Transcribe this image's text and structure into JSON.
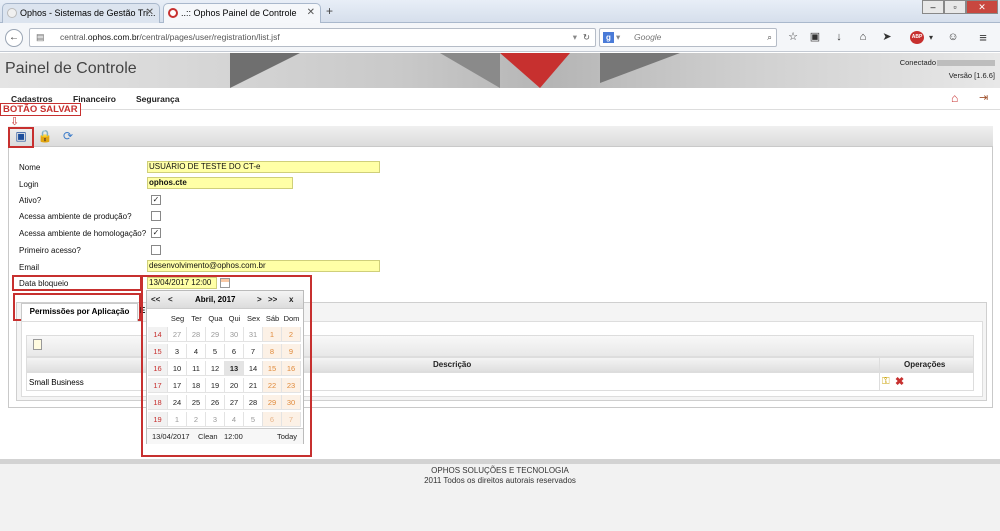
{
  "browser": {
    "tabs": [
      {
        "title": "Ophos - Sistemas de Gestão Tri...",
        "active": false
      },
      {
        "title": "..:: Ophos Painel de Controle",
        "active": true
      }
    ],
    "new_tab_label": "+",
    "url_prefix": "central.",
    "url_domain": "ophos.com.br",
    "url_path": "/central/pages/user/registration/list.jsf",
    "search_placeholder": "Google"
  },
  "app": {
    "title": "Painel de Controle",
    "connected_label": "Conectado",
    "version": "Versão [1.6.6]",
    "menu": [
      "Cadastros",
      "Financeiro",
      "Segurança"
    ]
  },
  "annotation": {
    "label": "BOTÃO SALVAR"
  },
  "form": {
    "fields": {
      "nome": {
        "label": "Nome",
        "value": "USUÁRIO DE TESTE DO CT-e"
      },
      "login": {
        "label": "Login",
        "value": "ophos.cte"
      },
      "ativo": {
        "label": "Ativo?",
        "checked": true
      },
      "producao": {
        "label": "Acessa ambiente de produção?",
        "checked": false
      },
      "homologacao": {
        "label": "Acessa ambiente de homologação?",
        "checked": true
      },
      "primeiro": {
        "label": "Primeiro acesso?",
        "checked": false
      },
      "email": {
        "label": "Email",
        "value": "desenvolvimento@ophos.com.br"
      },
      "bloqueio": {
        "label": "Data bloqueio",
        "value": "13/04/2017 12:00"
      }
    }
  },
  "tabs": {
    "permissoes": "Permissões por Aplicação",
    "second": "E"
  },
  "table": {
    "headers": {
      "descricao": "Descrição",
      "operacoes": "Operações"
    },
    "rows": [
      {
        "descricao": "Small Business"
      }
    ]
  },
  "calendar": {
    "nav_prev_year": "<<",
    "nav_prev_month": "<",
    "title": "Abril, 2017",
    "nav_next_month": ">",
    "nav_next_year": ">>",
    "close": "x",
    "weekdays": [
      "Seg",
      "Ter",
      "Qua",
      "Qui",
      "Sex",
      "Sáb",
      "Dom"
    ],
    "weeks": [
      {
        "wk": "14",
        "days": [
          "27",
          "28",
          "29",
          "30",
          "31",
          "1",
          "2"
        ]
      },
      {
        "wk": "15",
        "days": [
          "3",
          "4",
          "5",
          "6",
          "7",
          "8",
          "9"
        ]
      },
      {
        "wk": "16",
        "days": [
          "10",
          "11",
          "12",
          "13",
          "14",
          "15",
          "16"
        ]
      },
      {
        "wk": "17",
        "days": [
          "17",
          "18",
          "19",
          "20",
          "21",
          "22",
          "23"
        ]
      },
      {
        "wk": "18",
        "days": [
          "24",
          "25",
          "26",
          "27",
          "28",
          "29",
          "30"
        ]
      },
      {
        "wk": "19",
        "days": [
          "1",
          "2",
          "3",
          "4",
          "5",
          "6",
          "7"
        ]
      }
    ],
    "selected_day": "13",
    "footer": {
      "date": "13/04/2017",
      "clean": "Clean",
      "time": "12:00",
      "today": "Today"
    }
  },
  "footer": {
    "company": "OPHOS SOLUÇÕES E TECNOLOGIA",
    "copyright": "2011 Todos os direitos autorais reservados"
  },
  "colors": {
    "accent_red": "#c7302f",
    "input_yellow": "#ffffa6",
    "weekend_orange": "#e08a3a"
  }
}
